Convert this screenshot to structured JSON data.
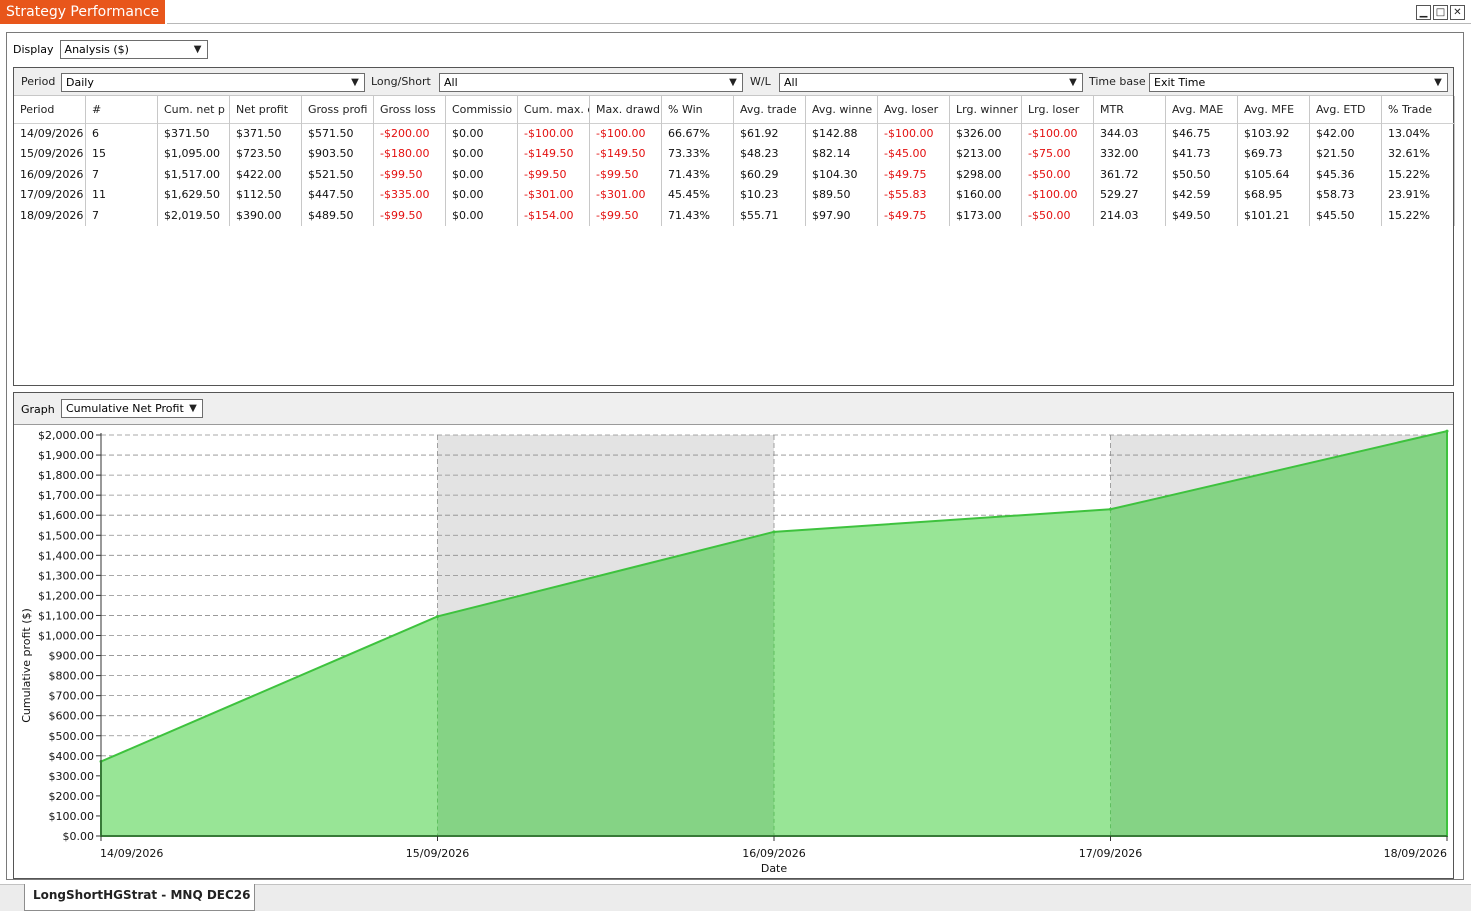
{
  "window": {
    "title": "Strategy Performance",
    "buttons": [
      "minimize-icon",
      "maximize-icon",
      "close-icon"
    ]
  },
  "display": {
    "label": "Display",
    "value": "Analysis ($)"
  },
  "filters": {
    "period_label": "Period",
    "period_value": "Daily",
    "longshort_label": "Long/Short",
    "longshort_value": "All",
    "wl_label": "W/L",
    "wl_value": "All",
    "timebase_label": "Time base",
    "timebase_value": "Exit Time"
  },
  "table": {
    "columns": [
      "Period",
      "#",
      "Cum. net p",
      "Net profit",
      "Gross profi",
      "Gross loss",
      "Commissio",
      "Cum. max. d",
      "Max. drawd",
      "% Win",
      "Avg. trade",
      "Avg. winne",
      "Avg. loser",
      "Lrg. winner",
      "Lrg. loser",
      "MTR",
      "Avg. MAE",
      "Avg. MFE",
      "Avg. ETD",
      "% Trade"
    ],
    "rows": [
      [
        "14/09/2026",
        "6",
        "$371.50",
        "$371.50",
        "$571.50",
        "-$200.00",
        "$0.00",
        "-$100.00",
        "-$100.00",
        "66.67%",
        "$61.92",
        "$142.88",
        "-$100.00",
        "$326.00",
        "-$100.00",
        "344.03",
        "$46.75",
        "$103.92",
        "$42.00",
        "13.04%"
      ],
      [
        "15/09/2026",
        "15",
        "$1,095.00",
        "$723.50",
        "$903.50",
        "-$180.00",
        "$0.00",
        "-$149.50",
        "-$149.50",
        "73.33%",
        "$48.23",
        "$82.14",
        "-$45.00",
        "$213.00",
        "-$75.00",
        "332.00",
        "$41.73",
        "$69.73",
        "$21.50",
        "32.61%"
      ],
      [
        "16/09/2026",
        "7",
        "$1,517.00",
        "$422.00",
        "$521.50",
        "-$99.50",
        "$0.00",
        "-$99.50",
        "-$99.50",
        "71.43%",
        "$60.29",
        "$104.30",
        "-$49.75",
        "$298.00",
        "-$50.00",
        "361.72",
        "$50.50",
        "$105.64",
        "$45.36",
        "15.22%"
      ],
      [
        "17/09/2026",
        "11",
        "$1,629.50",
        "$112.50",
        "$447.50",
        "-$335.00",
        "$0.00",
        "-$301.00",
        "-$301.00",
        "45.45%",
        "$10.23",
        "$89.50",
        "-$55.83",
        "$160.00",
        "-$100.00",
        "529.27",
        "$42.59",
        "$68.95",
        "$58.73",
        "23.91%"
      ],
      [
        "18/09/2026",
        "7",
        "$2,019.50",
        "$390.00",
        "$489.50",
        "-$99.50",
        "$0.00",
        "-$154.00",
        "-$99.50",
        "71.43%",
        "$55.71",
        "$97.90",
        "-$49.75",
        "$173.00",
        "-$50.00",
        "214.03",
        "$49.50",
        "$101.21",
        "$45.50",
        "15.22%"
      ]
    ],
    "negative_color": "#e31010"
  },
  "graph": {
    "label": "Graph",
    "value": "Cumulative Net Profit"
  },
  "chart_data": {
    "type": "area",
    "x": [
      "14/09/2026",
      "15/09/2026",
      "16/09/2026",
      "17/09/2026",
      "18/09/2026"
    ],
    "values": [
      371.5,
      1095.0,
      1517.0,
      1629.5,
      2019.5
    ],
    "xlabel": "Date",
    "ylabel": "Cumulative profit ($)",
    "ylim": [
      0,
      2000
    ],
    "ytick_step": 100,
    "y_tick_labels": [
      "$0.00",
      "$100.00",
      "$200.00",
      "$300.00",
      "$400.00",
      "$500.00",
      "$600.00",
      "$700.00",
      "$800.00",
      "$900.00",
      "$1,000.00",
      "$1,100.00",
      "$1,200.00",
      "$1,300.00",
      "$1,400.00",
      "$1,500.00",
      "$1,600.00",
      "$1,700.00",
      "$1,800.00",
      "$1,900.00",
      "$2,000.00"
    ],
    "grid": true,
    "colors": {
      "fill_light": "#98e596",
      "fill_dark": "#85d385",
      "line": "#3ec23e",
      "band": "#e3e3e3"
    }
  },
  "bottom_tab": {
    "label": "LongShortHGStrat - MNQ DEC26"
  }
}
